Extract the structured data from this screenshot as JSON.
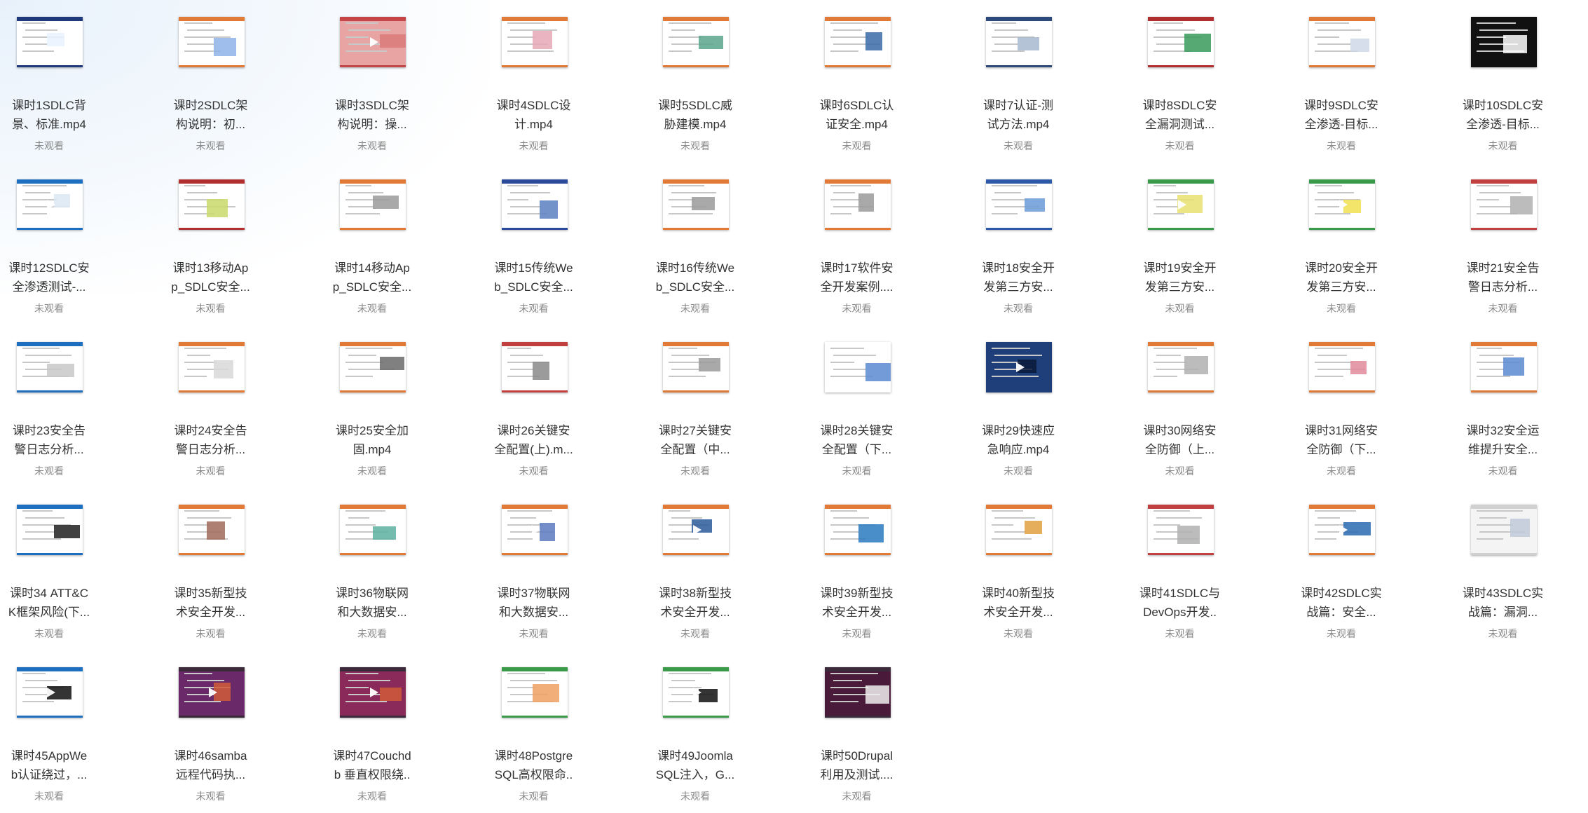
{
  "status_label": "未观看",
  "items": [
    {
      "line1": "课时1SDLC背",
      "line2": "景、标准.mp4",
      "thumb": {
        "bar": "#1f3a7a",
        "bg": "#ffffff",
        "accent": "#e9f2ff",
        "play": false
      }
    },
    {
      "line1": "课时2SDLC架",
      "line2": "构说明：初...",
      "thumb": {
        "bar": "#e07a36",
        "bg": "#ffffff",
        "accent": "#8fb3e8",
        "play": false
      }
    },
    {
      "line1": "课时3SDLC架",
      "line2": "构说明：操...",
      "thumb": {
        "bar": "#c44646",
        "bg": "#e8a3a3",
        "accent": "#d97a7a",
        "play": true
      }
    },
    {
      "line1": "课时4SDLC设",
      "line2": "计.mp4",
      "thumb": {
        "bar": "#e07a36",
        "bg": "#ffffff",
        "accent": "#e7a7b6",
        "play": false
      }
    },
    {
      "line1": "课时5SDLC威",
      "line2": "胁建模.mp4",
      "thumb": {
        "bar": "#e07a36",
        "bg": "#ffffff",
        "accent": "#5aa48c",
        "play": false
      }
    },
    {
      "line1": "课时6SDLC认",
      "line2": "证安全.mp4",
      "thumb": {
        "bar": "#e07a36",
        "bg": "#ffffff",
        "accent": "#3a6aa8",
        "play": false
      }
    },
    {
      "line1": "课时7认证-测",
      "line2": "试方法.mp4",
      "thumb": {
        "bar": "#2c4a7a",
        "bg": "#ffffff",
        "accent": "#a8b8d0",
        "play": false
      }
    },
    {
      "line1": "课时8SDLC安",
      "line2": "全漏洞测试...",
      "thumb": {
        "bar": "#b03030",
        "bg": "#ffffff",
        "accent": "#3a9a5a",
        "play": false
      }
    },
    {
      "line1": "课时9SDLC安",
      "line2": "全渗透-目标...",
      "thumb": {
        "bar": "#e07a36",
        "bg": "#ffffff",
        "accent": "#d0d8e8",
        "play": false
      }
    },
    {
      "line1": "课时10SDLC安",
      "line2": "全渗透-目标...",
      "thumb": {
        "bar": "#111111",
        "bg": "#111111",
        "accent": "#ffffff",
        "play": false
      }
    },
    {
      "line1": "课时12SDLC安",
      "line2": "全渗透测试-...",
      "thumb": {
        "bar": "#1e6fc0",
        "bg": "#ffffff",
        "accent": "#dbe7f5",
        "play": true
      }
    },
    {
      "line1": "课时13移动Ap",
      "line2": "p_SDLC安全...",
      "thumb": {
        "bar": "#b03030",
        "bg": "#ffffff",
        "accent": "#c9d96a",
        "play": false
      }
    },
    {
      "line1": "课时14移动Ap",
      "line2": "p_SDLC安全...",
      "thumb": {
        "bar": "#e07a36",
        "bg": "#ffffff",
        "accent": "#9a9a9a",
        "play": false
      }
    },
    {
      "line1": "课时15传统We",
      "line2": "b_SDLC安全...",
      "thumb": {
        "bar": "#2c4a9a",
        "bg": "#ffffff",
        "accent": "#5a7fc0",
        "play": false
      }
    },
    {
      "line1": "课时16传统We",
      "line2": "b_SDLC安全...",
      "thumb": {
        "bar": "#e07a36",
        "bg": "#ffffff",
        "accent": "#9a9a9a",
        "play": false
      }
    },
    {
      "line1": "课时17软件安",
      "line2": "全开发案例....",
      "thumb": {
        "bar": "#e07a36",
        "bg": "#ffffff",
        "accent": "#9a9a9a",
        "play": false
      }
    },
    {
      "line1": "课时18安全开",
      "line2": "发第三方安...",
      "thumb": {
        "bar": "#2c5aa8",
        "bg": "#ffffff",
        "accent": "#6a9ad8",
        "play": false
      }
    },
    {
      "line1": "课时19安全开",
      "line2": "发第三方安...",
      "thumb": {
        "bar": "#3a9a4a",
        "bg": "#ffffff",
        "accent": "#e8e070",
        "play": true
      }
    },
    {
      "line1": "课时20安全开",
      "line2": "发第三方安...",
      "thumb": {
        "bar": "#3a9a4a",
        "bg": "#ffffff",
        "accent": "#f0e050",
        "play": true
      }
    },
    {
      "line1": "课时21安全告",
      "line2": "警日志分析...",
      "thumb": {
        "bar": "#c04040",
        "bg": "#ffffff",
        "accent": "#b0b0b0",
        "play": false
      }
    },
    {
      "line1": "课时23安全告",
      "line2": "警日志分析...",
      "thumb": {
        "bar": "#1e6fc0",
        "bg": "#ffffff",
        "accent": "#c8c8c8",
        "play": false
      }
    },
    {
      "line1": "课时24安全告",
      "line2": "警日志分析...",
      "thumb": {
        "bar": "#e07a36",
        "bg": "#ffffff",
        "accent": "#d8d8d8",
        "play": false
      }
    },
    {
      "line1": "课时25安全加",
      "line2": "固.mp4",
      "thumb": {
        "bar": "#e07a36",
        "bg": "#ffffff",
        "accent": "#6a6a6a",
        "play": false
      }
    },
    {
      "line1": "课时26关键安",
      "line2": "全配置(上).m...",
      "thumb": {
        "bar": "#c04040",
        "bg": "#ffffff",
        "accent": "#8a8a8a",
        "play": false
      }
    },
    {
      "line1": "课时27关键安",
      "line2": "全配置（中...",
      "thumb": {
        "bar": "#e07a36",
        "bg": "#ffffff",
        "accent": "#9a9a9a",
        "play": false
      }
    },
    {
      "line1": "课时28关键安",
      "line2": "全配置（下...",
      "thumb": {
        "bar": "#ffffff",
        "bg": "#ffffff",
        "accent": "#5a8ad0",
        "play": false
      }
    },
    {
      "line1": "课时29快速应",
      "line2": "急响应.mp4",
      "thumb": {
        "bar": "#1e3f7a",
        "bg": "#1e3f7a",
        "accent": "#0a1a3a",
        "play": true
      }
    },
    {
      "line1": "课时30网络安",
      "line2": "全防御（上...",
      "thumb": {
        "bar": "#e07a36",
        "bg": "#ffffff",
        "accent": "#b0b0b0",
        "play": false
      }
    },
    {
      "line1": "课时31网络安",
      "line2": "全防御（下...",
      "thumb": {
        "bar": "#e07a36",
        "bg": "#ffffff",
        "accent": "#e08a9a",
        "play": false
      }
    },
    {
      "line1": "课时32安全运",
      "line2": "维提升安全...",
      "thumb": {
        "bar": "#e07a36",
        "bg": "#ffffff",
        "accent": "#5a8ad0",
        "play": false
      }
    },
    {
      "line1": "课时34 ATT&C",
      "line2": "K框架风险(下...",
      "thumb": {
        "bar": "#1e6fc0",
        "bg": "#ffffff",
        "accent": "#202020",
        "play": false
      }
    },
    {
      "line1": "课时35新型技",
      "line2": "术安全开发...",
      "thumb": {
        "bar": "#e07a36",
        "bg": "#ffffff",
        "accent": "#a06a5a",
        "play": false
      }
    },
    {
      "line1": "课时36物联网",
      "line2": "和大数据安...",
      "thumb": {
        "bar": "#e07a36",
        "bg": "#ffffff",
        "accent": "#5ab0a0",
        "play": false
      }
    },
    {
      "line1": "课时37物联网",
      "line2": "和大数据安...",
      "thumb": {
        "bar": "#e07a36",
        "bg": "#ffffff",
        "accent": "#5a7ac0",
        "play": true
      }
    },
    {
      "line1": "课时38新型技",
      "line2": "术安全开发...",
      "thumb": {
        "bar": "#e07a36",
        "bg": "#ffffff",
        "accent": "#2a5a9a",
        "play": true
      }
    },
    {
      "line1": "课时39新型技",
      "line2": "术安全开发...",
      "thumb": {
        "bar": "#e07a36",
        "bg": "#ffffff",
        "accent": "#2a7ac0",
        "play": false
      }
    },
    {
      "line1": "课时40新型技",
      "line2": "术安全开发...",
      "thumb": {
        "bar": "#e07a36",
        "bg": "#ffffff",
        "accent": "#e0a040",
        "play": false
      }
    },
    {
      "line1": "课时41SDLC与",
      "line2": "DevOps开发..",
      "thumb": {
        "bar": "#c04040",
        "bg": "#ffffff",
        "accent": "#b0b0b0",
        "play": false
      }
    },
    {
      "line1": "课时42SDLC实",
      "line2": "战篇：安全...",
      "thumb": {
        "bar": "#e07a36",
        "bg": "#ffffff",
        "accent": "#2a6ab0",
        "play": true
      }
    },
    {
      "line1": "课时43SDLC实",
      "line2": "战篇：漏洞...",
      "thumb": {
        "bar": "#d0d0d0",
        "bg": "#f4f4f4",
        "accent": "#c0c8d8",
        "play": false
      }
    },
    {
      "line1": "课时45AppWe",
      "line2": "b认证绕过，...",
      "thumb": {
        "bar": "#1e6fc0",
        "bg": "#ffffff",
        "accent": "#111111",
        "play": true
      }
    },
    {
      "line1": "课时46samba",
      "line2": "远程代码执...",
      "thumb": {
        "bar": "#3a2a3a",
        "bg": "#6a2a6a",
        "accent": "#d05a3a",
        "play": true
      }
    },
    {
      "line1": "课时47Couchd",
      "line2": "b 垂直权限绕..",
      "thumb": {
        "bar": "#3a2a3a",
        "bg": "#8a2a5a",
        "accent": "#d05a3a",
        "play": true
      }
    },
    {
      "line1": "课时48Postgre",
      "line2": "SQL高权限命..",
      "thumb": {
        "bar": "#3a9a4a",
        "bg": "#ffffff",
        "accent": "#f0a060",
        "play": false
      }
    },
    {
      "line1": "课时49Joomla",
      "line2": "SQL注入，G...",
      "thumb": {
        "bar": "#3a9a4a",
        "bg": "#ffffff",
        "accent": "#111111",
        "play": true
      }
    },
    {
      "line1": "课时50Drupal",
      "line2": "利用及测试....",
      "thumb": {
        "bar": "#3a2a3a",
        "bg": "#4a1a3a",
        "accent": "#f0f0f0",
        "play": false
      }
    }
  ]
}
